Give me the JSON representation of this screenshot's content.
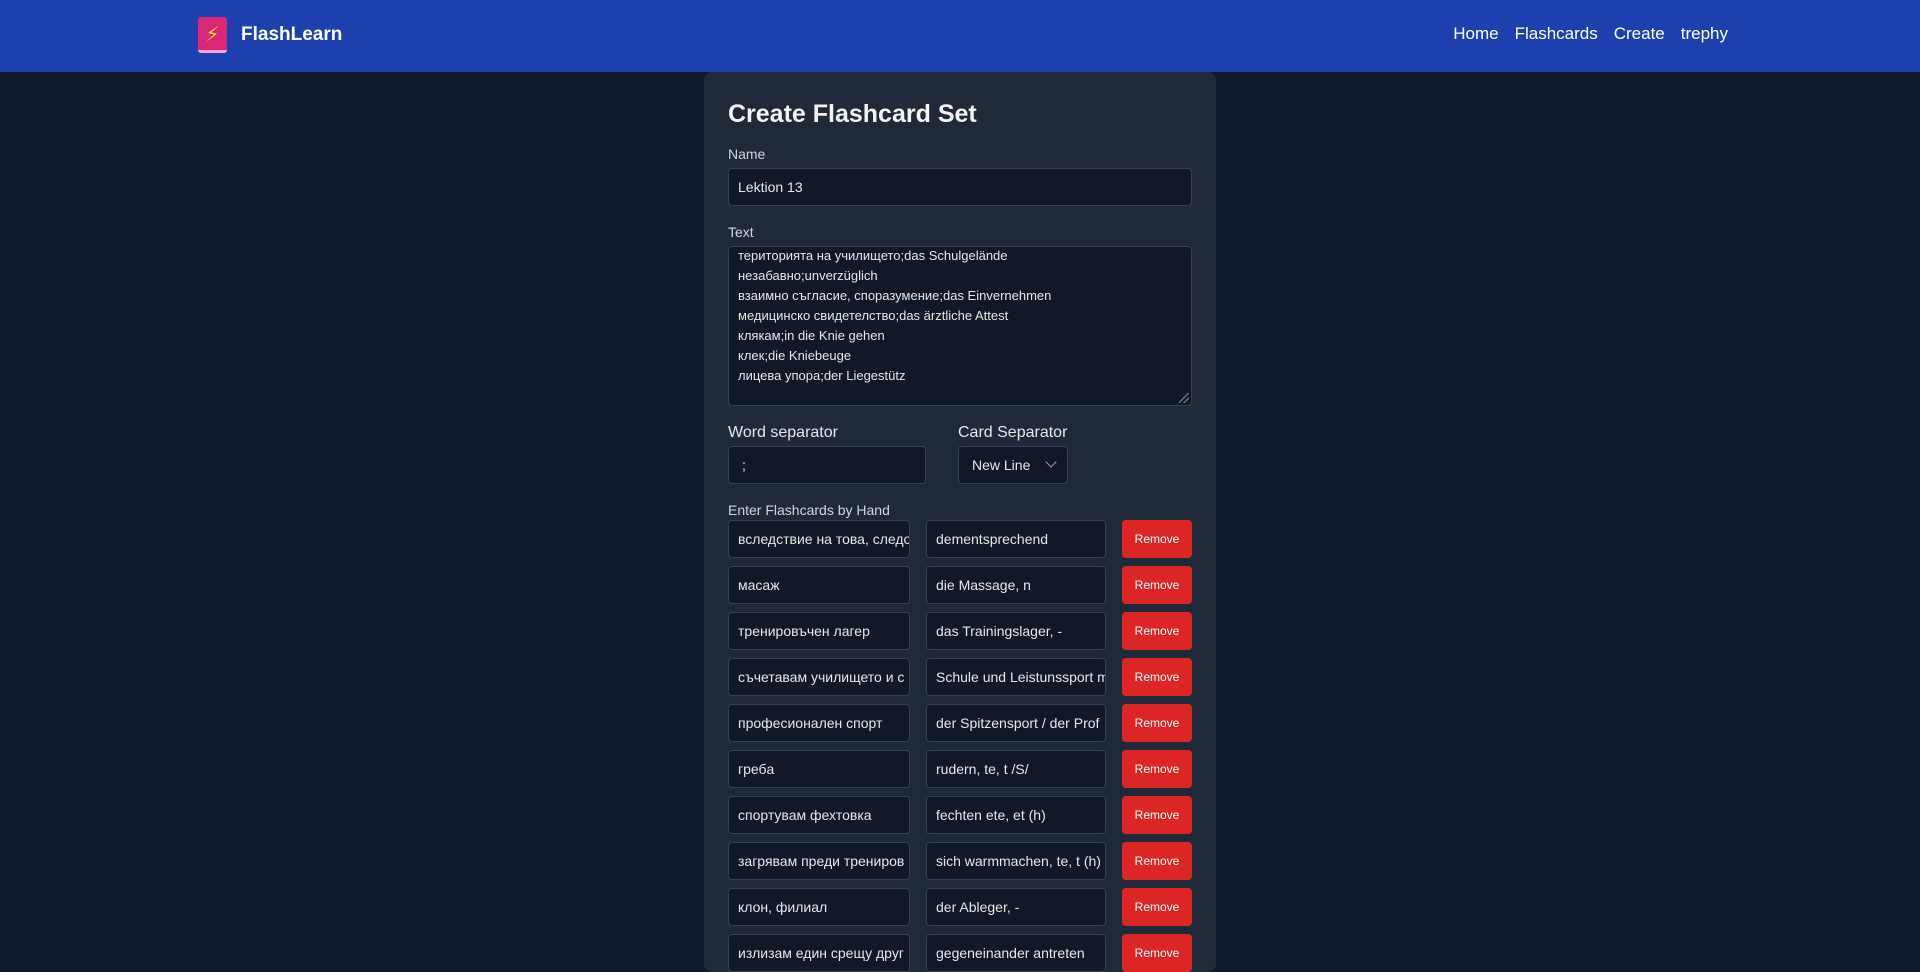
{
  "navbar": {
    "brand": "FlashLearn",
    "links": [
      "Home",
      "Flashcards",
      "Create",
      "trephy"
    ]
  },
  "form": {
    "title": "Create Flashcard Set",
    "name_label": "Name",
    "name_value": "Lektion 13",
    "text_label": "Text",
    "text_lines": [
      "територията на училището;das Schulgelände",
      "незабавно;unverzüglich",
      "взаимно съгласие, споразумение;das Einvernehmen",
      "медицинско свидетелство;das ärztliche Attest",
      "клякам;in die Knie gehen",
      "клек;die Kniebeuge",
      "лицева упора;der Liegestütz"
    ],
    "word_separator_label": "Word separator",
    "word_separator_value": ";",
    "card_separator_label": "Card Separator",
    "card_separator_value": "New Line",
    "manual_label": "Enter Flashcards by Hand",
    "remove_label": "Remove",
    "cards": [
      {
        "front": "вследствие на това, следо",
        "back": "dementsprechend"
      },
      {
        "front": "масаж",
        "back": "die Massage, n"
      },
      {
        "front": "тренировъчен лагер",
        "back": "das Trainingslager, -"
      },
      {
        "front": "съчетавам училището и с",
        "back": "Schule und Leistunssport m"
      },
      {
        "front": "професионален спорт",
        "back": "der Spitzensport / der Prof"
      },
      {
        "front": "гребa",
        "back": "rudern, te, t /S/"
      },
      {
        "front": "спортувам фехтовка",
        "back": "fechten ete, et (h)"
      },
      {
        "front": "загрявам преди трениров",
        "back": "sich warmmachen, te, t (h)"
      },
      {
        "front": "клон, филиал",
        "back": "der Ableger, -"
      },
      {
        "front": "излизам един срещу друг",
        "back": "gegeneinander antreten"
      }
    ]
  },
  "colors": {
    "navbar": "#1e40af",
    "background": "#0f172a",
    "card": "#1f2937",
    "remove": "#dc2626"
  }
}
